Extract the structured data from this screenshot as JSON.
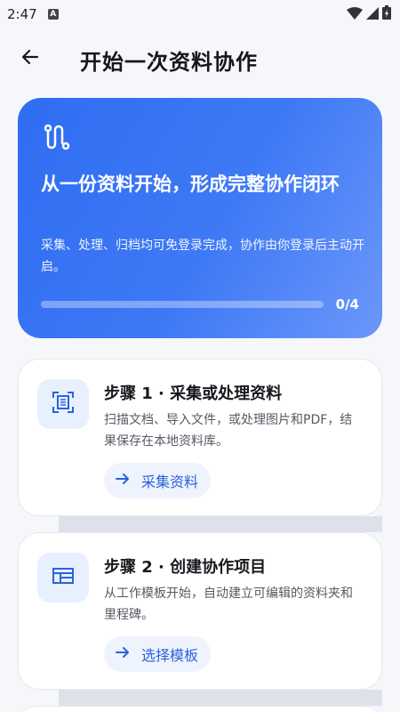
{
  "status_bar": {
    "time": "2:47",
    "notification_icon": "a-icon",
    "icons": [
      "wifi-icon",
      "signal-icon",
      "battery-icon"
    ]
  },
  "app_bar": {
    "back_icon": "arrow-left-icon",
    "title": "开始一次资料协作"
  },
  "hero": {
    "icon": "route-icon",
    "heading": "从一份资料开始，形成完整协作闭环",
    "description": "采集、处理、归档均可免登录完成，协作由你登录后主动开启。",
    "progress": {
      "completed": 0,
      "total": 4,
      "label": "0/4"
    },
    "colors": {
      "gradient_start": "#2f6df2",
      "gradient_end": "#6c97fa"
    }
  },
  "steps": [
    {
      "icon": "document-scan-icon",
      "title": "步骤 1 · 采集或处理资料",
      "description": "扫描文档、导入文件，或处理图片和PDF，结果保存在本地资料库。",
      "action_label": "采集资料",
      "action_icon": "arrow-right-icon"
    },
    {
      "icon": "template-layout-icon",
      "title": "步骤 2 · 创建协作项目",
      "description": "从工作模板开始，自动建立可编辑的资料夹和里程碑。",
      "action_label": "选择模板",
      "action_icon": "arrow-right-icon"
    }
  ],
  "accent_color": "#2a63d8"
}
